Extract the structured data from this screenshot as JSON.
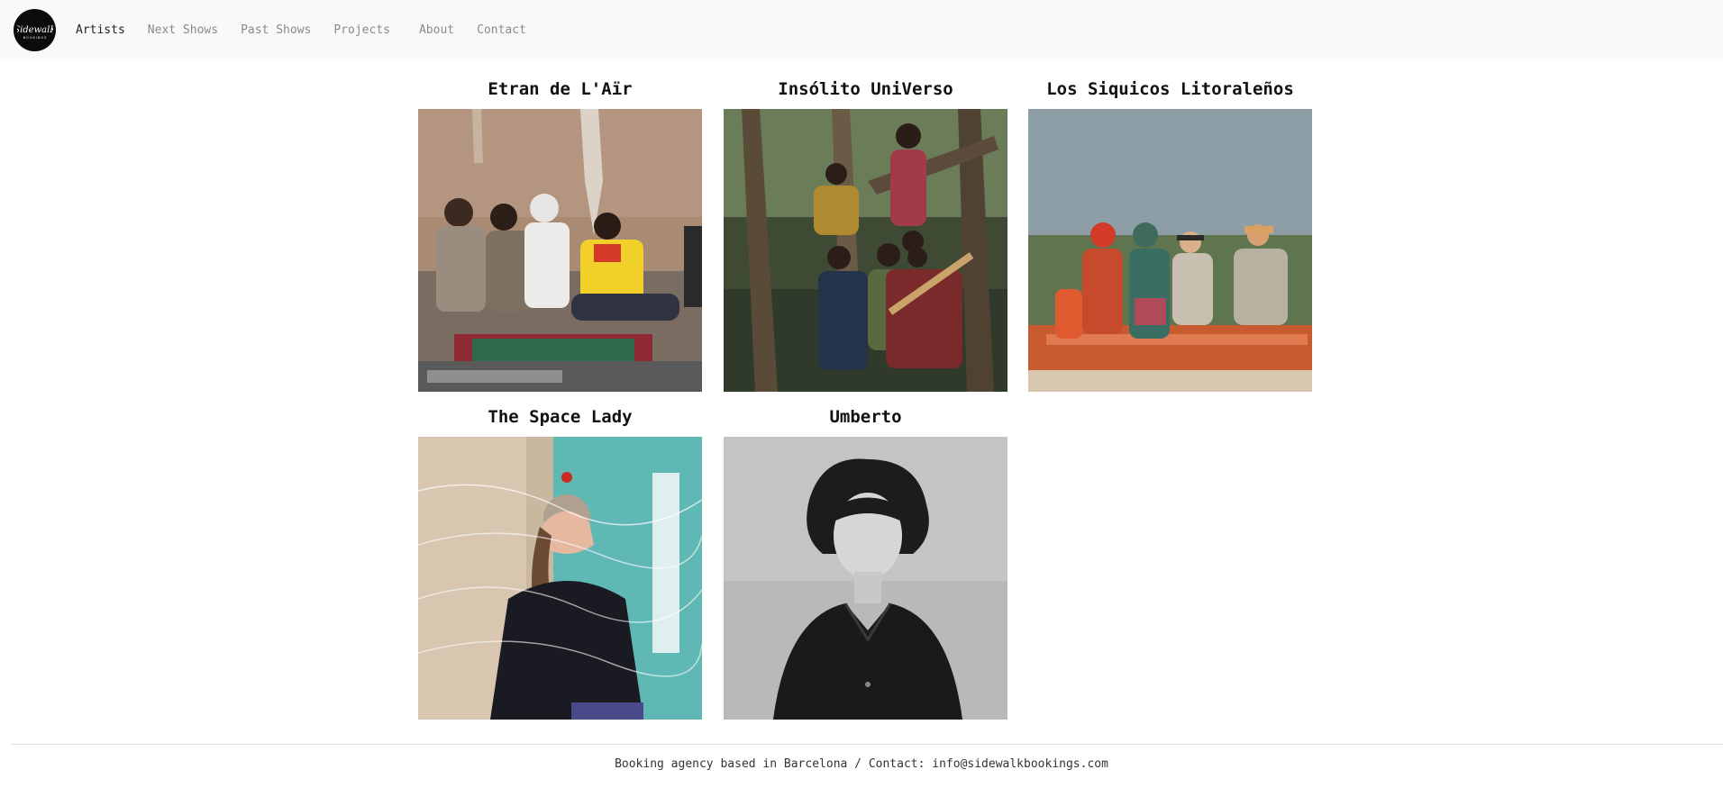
{
  "brand": {
    "logo_text": "SidewalK",
    "logo_subtext": "BOOKINGS"
  },
  "nav": {
    "items": [
      {
        "label": "Artists",
        "active": true
      },
      {
        "label": "Next Shows",
        "active": false
      },
      {
        "label": "Past Shows",
        "active": false
      },
      {
        "label": "Projects",
        "active": false
      },
      {
        "label": "About",
        "active": false
      },
      {
        "label": "Contact",
        "active": false
      }
    ]
  },
  "artists": [
    {
      "name": "Etran de L'Aïr"
    },
    {
      "name": "Insólito UniVerso"
    },
    {
      "name": "Los Siquicos Litoraleños"
    },
    {
      "name": "The Space Lady"
    },
    {
      "name": "Umberto"
    }
  ],
  "footer": {
    "text": "Booking agency based in Barcelona / Contact: info@sidewalkbookings.com"
  },
  "colors": {
    "navbar_bg": "#f8f9fa",
    "active_link": "#222222",
    "inactive_link": "#8a8a8a"
  }
}
